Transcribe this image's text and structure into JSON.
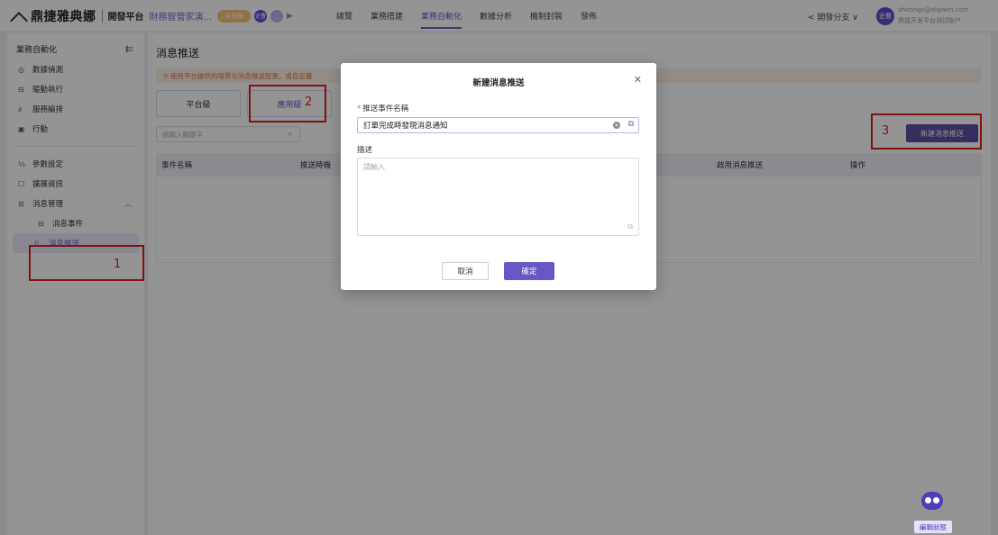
{
  "topbar": {
    "brand": "鼎捷雅典娜",
    "platform": "開發平台",
    "project": "財務智管家演...",
    "status_pill": "未發佈",
    "avatar_a": "史曹",
    "nav": [
      "總覽",
      "業務搭建",
      "業務自動化",
      "數據分析",
      "機制封裝",
      "發佈"
    ],
    "branch": "開發分支 ∨",
    "user_avatar": "史曹",
    "user_email": "shirongs@digiwin.com",
    "user_role": "鼎捷开发平台测试账户"
  },
  "sidebar": {
    "title": "業務自動化",
    "group1": [
      "數據偵測",
      "驅動執行",
      "服務編排",
      "行動"
    ],
    "group2": [
      "參數設定",
      "擴展資訊",
      "消息管理"
    ],
    "sub_items": [
      "消息事件",
      "消息推送"
    ]
  },
  "main": {
    "page_title": "消息推送",
    "notice": "使用平台提供的場景化消息推送配置，或自定義",
    "tabs": [
      "平台級",
      "應用級"
    ],
    "search_placeholder": "請輸入關鍵字",
    "new_button": "新建消息推送",
    "columns": [
      "事件名稱",
      "推送時機",
      "啟用消息推送",
      "操作"
    ]
  },
  "annotations": [
    "1",
    "2",
    "3"
  ],
  "modal": {
    "title": "新建消息推送",
    "field1_label": "推送事件名稱",
    "field1_value": "訂單完成時發現消息通知",
    "field2_label": "描述",
    "field2_placeholder": "請輸入",
    "cancel": "取消",
    "ok": "確定"
  },
  "edit_state": "編輯狀態",
  "colors": {
    "accent": "#6a5acd",
    "annotation": "#e0201b",
    "warning": "#e07a3c"
  }
}
